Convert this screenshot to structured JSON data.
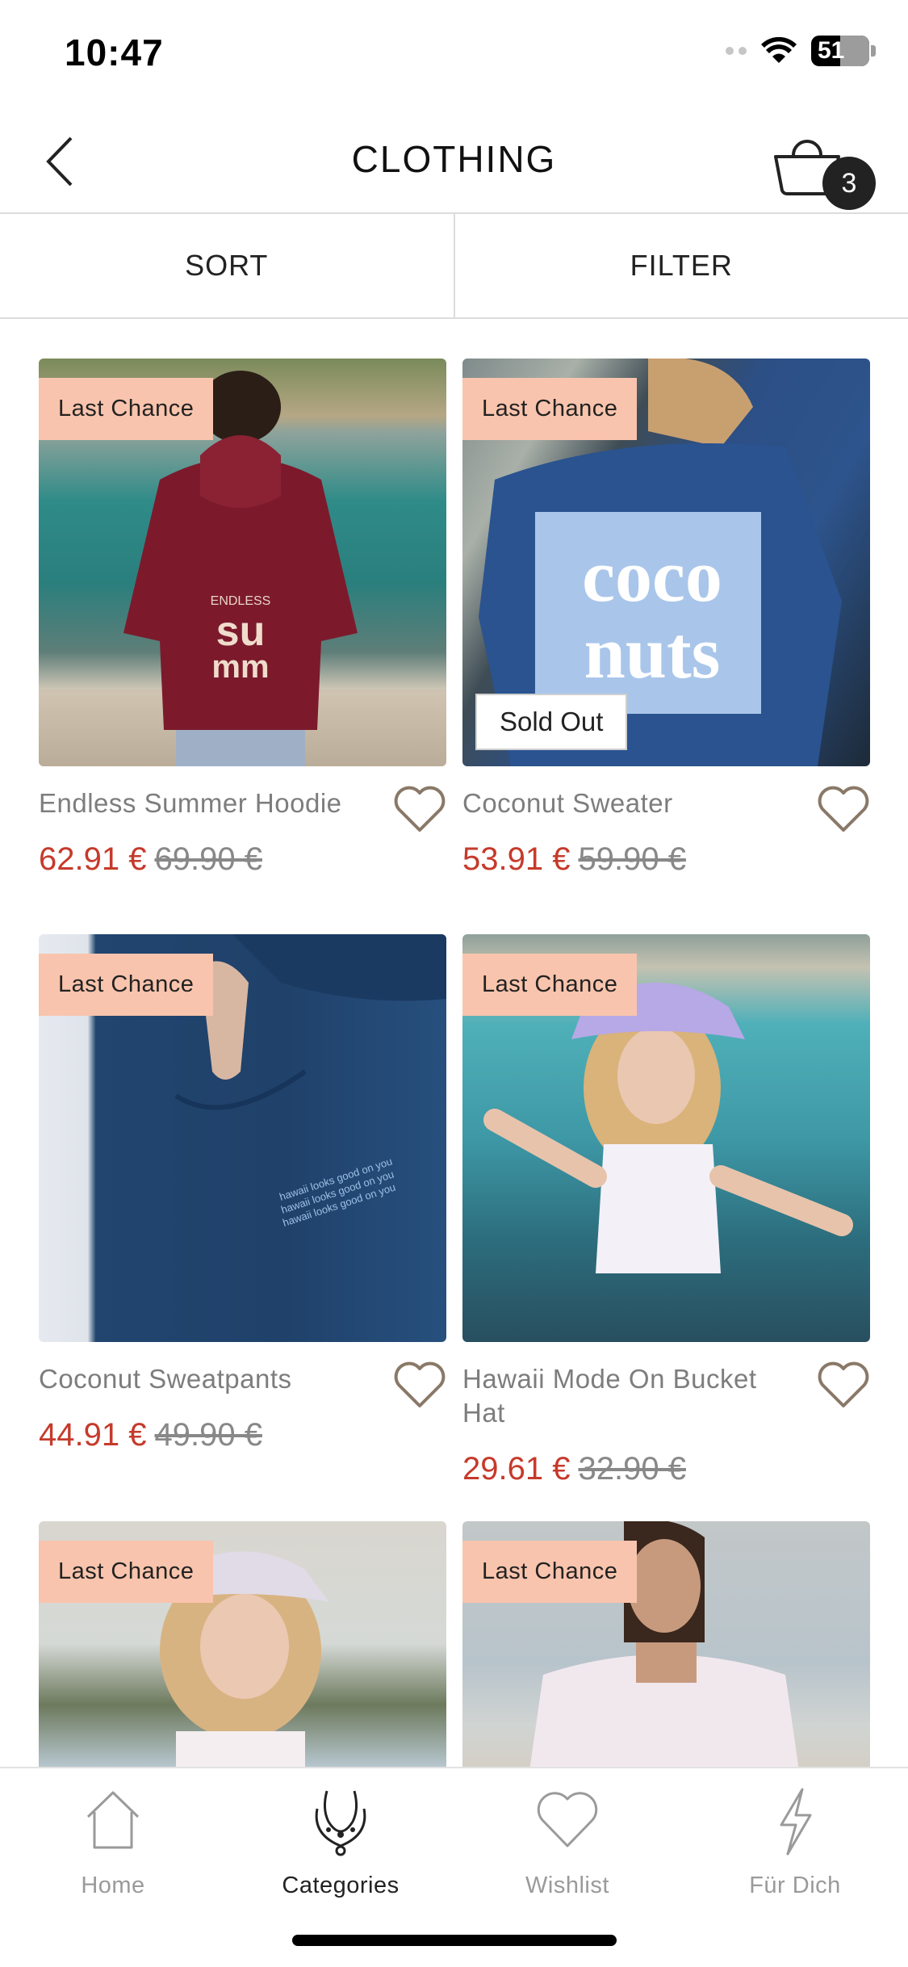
{
  "status_bar": {
    "time": "10:47",
    "battery": "51"
  },
  "header": {
    "title": "CLOTHING",
    "cart_count": "3"
  },
  "toolbar": {
    "sort_label": "SORT",
    "filter_label": "FILTER"
  },
  "products": [
    {
      "name": "Endless Summer Hoodie",
      "tag": "Last Chance",
      "price": "62.91 €",
      "old_price": "69.90 €",
      "image": "Endless Summer hoodie"
    },
    {
      "name": "Coconut Sweater",
      "tag": "Last Chance",
      "badge": "Sold Out",
      "price": "53.91 €",
      "old_price": "59.90 €",
      "image": "Coconut sweater"
    },
    {
      "name": "Coconut Sweatpants",
      "tag": "Last Chance",
      "price": "44.91 €",
      "old_price": "49.90 €",
      "image": "Coconut sweatpants"
    },
    {
      "name": "Hawaii Mode On Bucket Hat",
      "tag": "Last Chance",
      "price": "29.61 €",
      "old_price": "32.90 €",
      "image": "Bucket hat"
    },
    {
      "name": "",
      "tag": "Last Chance",
      "image": "Bucket hat on beach"
    },
    {
      "name": "",
      "tag": "Last Chance",
      "image": "T-shirt on beach"
    }
  ],
  "bottom_nav": [
    {
      "label": "Home",
      "icon": "home-icon"
    },
    {
      "label": "Categories",
      "icon": "necklace-icon",
      "active": true
    },
    {
      "label": "Wishlist",
      "icon": "heart-icon"
    },
    {
      "label": "Für Dich",
      "icon": "lightning-icon"
    }
  ],
  "colors": {
    "sale_price": "#c63a2b",
    "tag_bg": "#f9c4ad",
    "accent": "#222222"
  }
}
